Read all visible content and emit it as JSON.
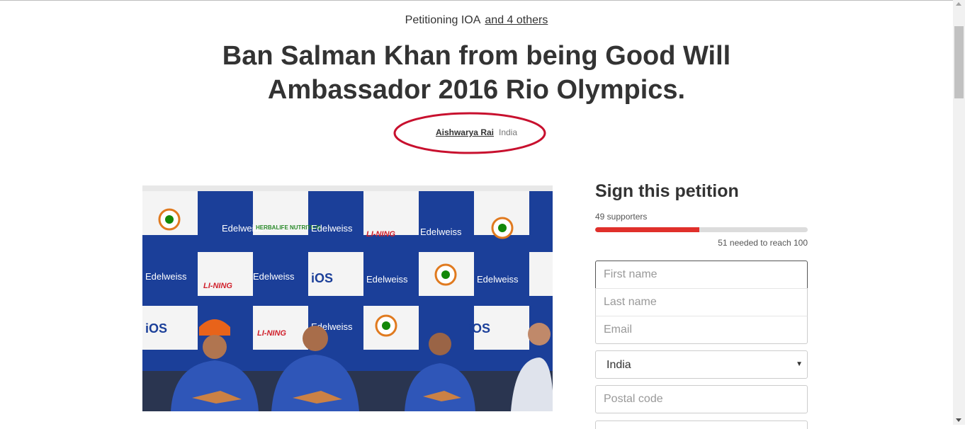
{
  "header": {
    "petitioning_prefix": "Petitioning IOA",
    "others_link": "and 4 others",
    "title": "Ban Salman Khan from being Good Will Ambassador 2016 Rio Olympics.",
    "author_name": "Aishwarya Rai",
    "author_location": "India"
  },
  "photo": {
    "sponsor_logos": [
      "Edelweiss",
      "HERBALIFE NUTRITION",
      "LI-NING",
      "iOS"
    ]
  },
  "sidebar": {
    "title": "Sign this petition",
    "supporters_text": "49 supporters",
    "progress_fraction": 0.49,
    "needed_text": "51 needed to reach 100",
    "first_name_placeholder": "First name",
    "last_name_placeholder": "Last name",
    "email_placeholder": "Email",
    "country_value": "India",
    "postal_placeholder": "Postal code"
  },
  "colors": {
    "accent_red": "#e0302b",
    "highlight_ring": "#c8102e",
    "backdrop_blue": "#1b3f99"
  }
}
